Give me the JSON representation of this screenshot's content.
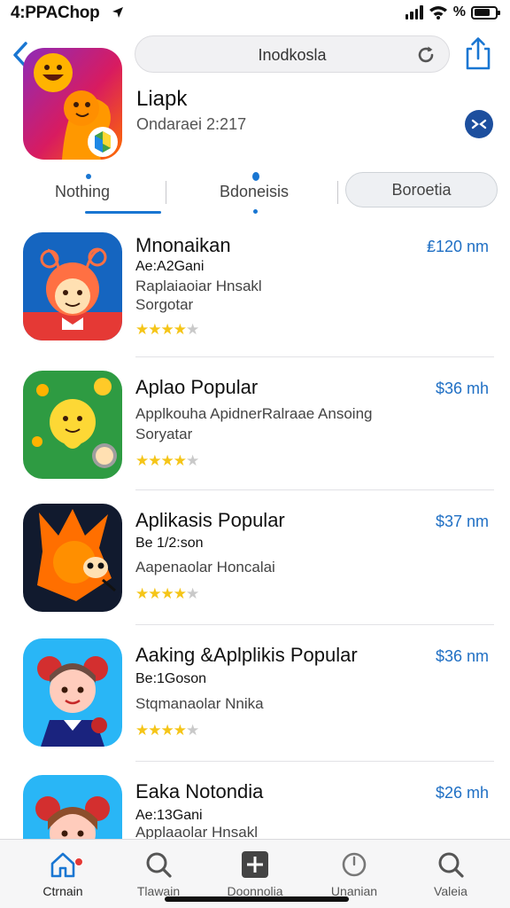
{
  "status_bar": {
    "time": "4:PPAChop",
    "battery_label": "%"
  },
  "nav": {
    "search_text": "Inodkosla"
  },
  "header": {
    "app_name": "Liapk",
    "subtitle": "Ondaraei 2:217"
  },
  "tabs": [
    {
      "label": "Nothing"
    },
    {
      "label": "Bdoneisis"
    },
    {
      "label": "Boroetia"
    }
  ],
  "apps": [
    {
      "title": "Mnonaikan",
      "price": "₤120 nm",
      "meta": "Ae:A2Gani",
      "desc": "Raplaiaoiar Hnsakl",
      "category": "Sorgotar",
      "rating": 4
    },
    {
      "title": "Aplao Popular",
      "price": "$36 mh",
      "meta": "",
      "desc": "Applkouha ApidnerRalraae Ansoing",
      "category": "Soryatar",
      "rating": 4
    },
    {
      "title": "Aplikasis Popular",
      "price": "$37 nm",
      "meta": "Be 1/2:son",
      "desc": "Aapenaolar Honcalai",
      "category": "",
      "rating": 4
    },
    {
      "title": "Aaking &Aplplikis Popular",
      "price": "$36 nm",
      "meta": "Be:1Goson",
      "desc": "Stqmanaolar Nnika",
      "category": "",
      "rating": 4
    },
    {
      "title": "Eaka Notondia",
      "price": "$26 mh",
      "meta": "Ae:13Gani",
      "desc": "Applaaolar Hnsakl",
      "category": "",
      "rating": 0
    }
  ],
  "tab_bar": [
    {
      "label": "Ctrnain",
      "icon": "home-icon"
    },
    {
      "label": "Tlawain",
      "icon": "search-icon"
    },
    {
      "label": "Doonnolia",
      "icon": "plus-square-icon"
    },
    {
      "label": "Unanian",
      "icon": "circle-icon"
    },
    {
      "label": "Valeia",
      "icon": "search-icon"
    }
  ],
  "colors": {
    "accent": "#1976d2",
    "price": "#1f6fc4",
    "star": "#f5c518"
  }
}
